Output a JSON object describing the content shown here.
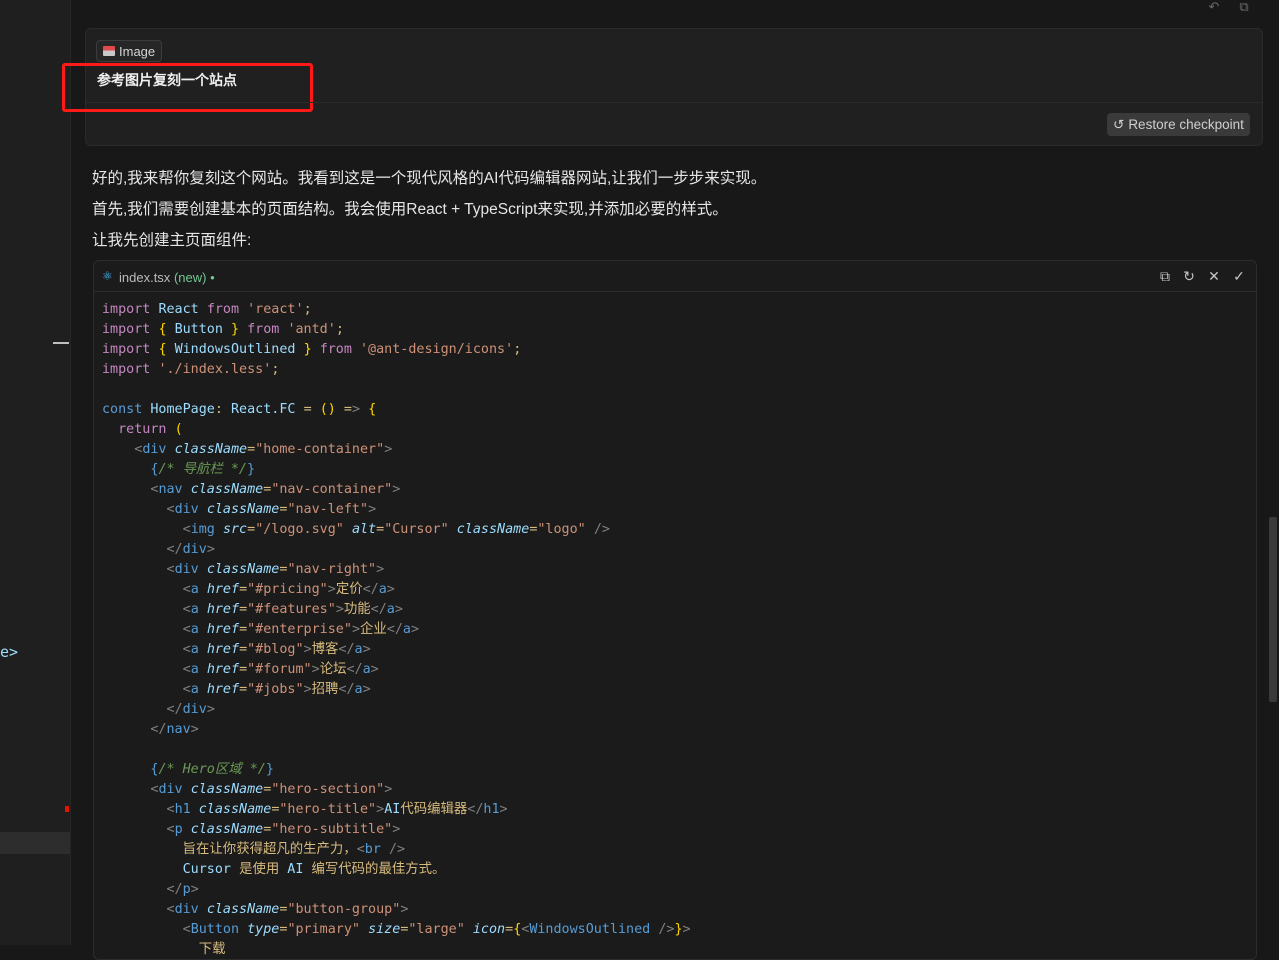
{
  "window": {
    "top_actions": [
      "undo-icon",
      "copy-icon"
    ]
  },
  "left_panel": {
    "fragment_text": "e>"
  },
  "message": {
    "attachment_label": "Image",
    "attachment_icon": "image-icon",
    "text": "参考图片复刻一个站点",
    "restore_label": "Restore checkpoint",
    "highlight_color": "#ff1a1a"
  },
  "response": {
    "paragraphs": [
      "好的,我来帮你复刻这个网站。我看到这是一个现代风格的AI代码编辑器网站,让我们一步步来实现。",
      "首先,我们需要创建基本的页面结构。我会使用React + TypeScript来实现,并添加必要的样式。",
      "让我先创建主页面组件:"
    ]
  },
  "code_block": {
    "file_name": "index.tsx",
    "status": "(new)",
    "status_dot": "•",
    "actions": [
      "copy-icon",
      "refresh-icon",
      "close-icon",
      "check-icon"
    ],
    "lines": [
      "import React from 'react';",
      "import { Button } from 'antd';",
      "import { WindowsOutlined } from '@ant-design/icons';",
      "import './index.less';",
      "",
      "const HomePage: React.FC = () => {",
      "  return (",
      "    <div className=\"home-container\">",
      "      {/* 导航栏 */}",
      "      <nav className=\"nav-container\">",
      "        <div className=\"nav-left\">",
      "          <img src=\"/logo.svg\" alt=\"Cursor\" className=\"logo\" />",
      "        </div>",
      "        <div className=\"nav-right\">",
      "          <a href=\"#pricing\">定价</a>",
      "          <a href=\"#features\">功能</a>",
      "          <a href=\"#enterprise\">企业</a>",
      "          <a href=\"#blog\">博客</a>",
      "          <a href=\"#forum\">论坛</a>",
      "          <a href=\"#jobs\">招聘</a>",
      "        </div>",
      "      </nav>",
      "",
      "      {/* Hero区域 */}",
      "      <div className=\"hero-section\">",
      "        <h1 className=\"hero-title\">AI代码编辑器</h1>",
      "        <p className=\"hero-subtitle\">",
      "          旨在让你获得超凡的生产力，<br />",
      "          Cursor 是使用 AI 编写代码的最佳方式。",
      "        </p>",
      "        <div className=\"button-group\">",
      "          <Button type=\"primary\" size=\"large\" icon={<WindowsOutlined />}>",
      "            下载"
    ]
  }
}
